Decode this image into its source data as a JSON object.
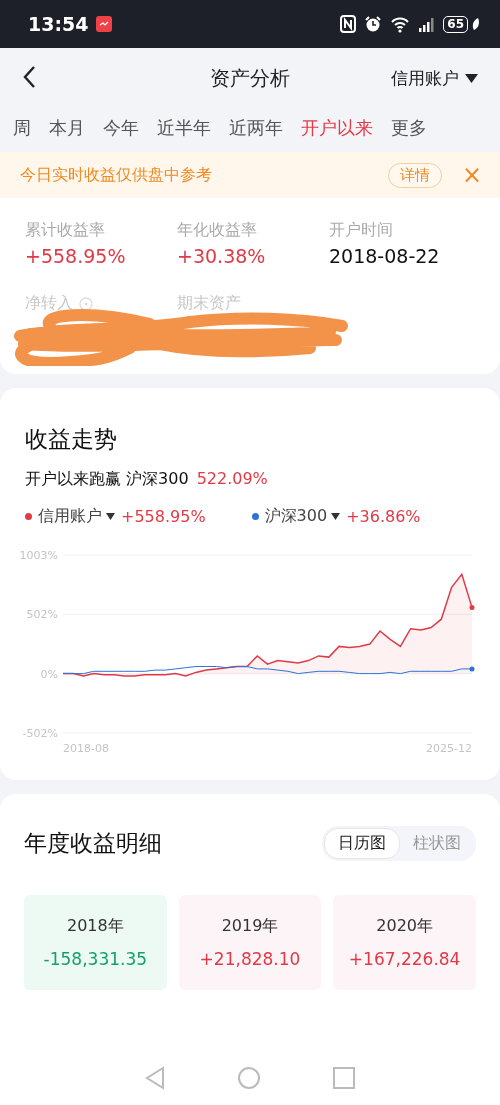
{
  "status_bar": {
    "time": "13:54",
    "battery": "65"
  },
  "header": {
    "title": "资产分析",
    "account": "信用账户"
  },
  "tabs": [
    {
      "label": "周",
      "selected": false
    },
    {
      "label": "本月",
      "selected": false
    },
    {
      "label": "今年",
      "selected": false
    },
    {
      "label": "近半年",
      "selected": false
    },
    {
      "label": "近两年",
      "selected": false
    },
    {
      "label": "开户以来",
      "selected": true
    },
    {
      "label": "更多",
      "selected": false
    }
  ],
  "notice": {
    "text": "今日实时收益仅供盘中参考",
    "button": "详情",
    "close": "×"
  },
  "summary": {
    "metrics": [
      {
        "label": "累计收益率",
        "value": "+558.95%",
        "kind": "gain"
      },
      {
        "label": "年化收益率",
        "value": "+30.38%",
        "kind": "gain"
      },
      {
        "label": "开户时间",
        "value": "2018-08-22",
        "kind": "plain"
      }
    ],
    "hidden_labels": [
      "净转入",
      "期末资产"
    ]
  },
  "trend": {
    "title": "收益走势",
    "summary": "开户以来跑赢 沪深300",
    "summary_value": "522.09%",
    "legend": [
      {
        "value": "+558.95%"
      },
      {
        "value": "+36.86%"
      }
    ],
    "x_start_label": "2018-08",
    "x_end_label": "2025-12",
    "chart_data": {
      "type": "area",
      "ylim": [
        -502,
        1003
      ],
      "yticks": [
        {
          "value": 1003,
          "label": "1003%"
        },
        {
          "value": 502,
          "label": "502%"
        },
        {
          "value": 0,
          "label": "0%"
        },
        {
          "value": -502,
          "label": "-502%"
        }
      ],
      "series": [
        {
          "name": "信用账户",
          "color": "#e03a47",
          "values": [
            0,
            0,
            -20,
            0,
            -10,
            -10,
            -20,
            -20,
            -10,
            -10,
            -10,
            0,
            -20,
            10,
            30,
            40,
            50,
            60,
            60,
            150,
            80,
            110,
            100,
            90,
            110,
            150,
            140,
            230,
            220,
            230,
            250,
            360,
            290,
            230,
            380,
            370,
            390,
            460,
            730,
            840,
            560
          ]
        },
        {
          "name": "沪深300",
          "color": "#2f72d8",
          "type": "line",
          "values": [
            0,
            0,
            0,
            20,
            20,
            20,
            20,
            20,
            20,
            30,
            30,
            40,
            50,
            60,
            60,
            60,
            50,
            60,
            60,
            40,
            40,
            30,
            20,
            0,
            10,
            20,
            20,
            20,
            10,
            0,
            0,
            0,
            10,
            0,
            20,
            20,
            20,
            20,
            20,
            40,
            40
          ]
        }
      ]
    }
  },
  "yearly": {
    "title": "年度收益明细",
    "views": [
      {
        "label": "日历图",
        "selected": true
      },
      {
        "label": "柱状图",
        "selected": false
      }
    ],
    "years": [
      {
        "year": "2018年",
        "value": "-158,331.35",
        "kind": "loss"
      },
      {
        "year": "2019年",
        "value": "+21,828.10",
        "kind": "gain"
      },
      {
        "year": "2020年",
        "value": "+167,226.84",
        "kind": "gain"
      }
    ]
  }
}
